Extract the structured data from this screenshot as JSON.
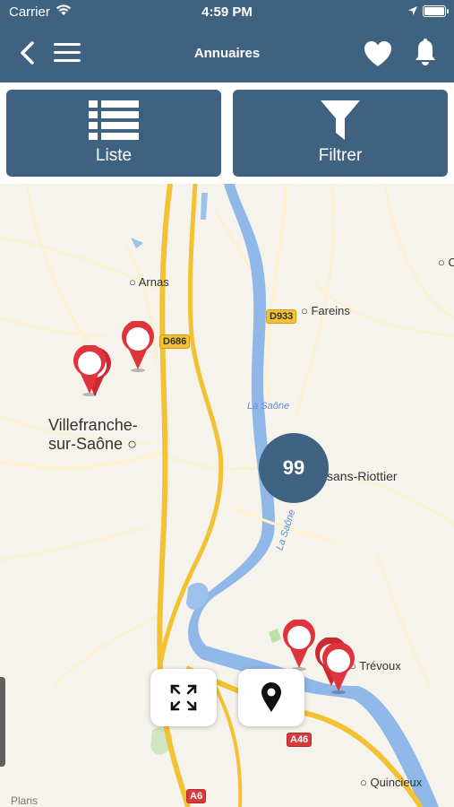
{
  "status_bar": {
    "carrier": "Carrier",
    "time": "4:59 PM"
  },
  "nav": {
    "title": "Annuaires"
  },
  "toolbar": {
    "list_label": "Liste",
    "filter_label": "Filtrer"
  },
  "map": {
    "places": {
      "arnas": "Arnas",
      "fareins": "Fareins",
      "villefranche_line1": "Villefranche-",
      "villefranche_line2": "sur-Saône",
      "riottier": "sans-Riottier",
      "trevoux": "Trévoux",
      "quincieux": "Quincieux"
    },
    "roads": {
      "d686": "D686",
      "d933": "D933",
      "a46": "A46",
      "a6": "A6"
    },
    "river_labels": {
      "saone_top": "La Saône",
      "saone_mid": "La Saône"
    },
    "cluster_count": "99",
    "attribution": "Plans"
  },
  "colors": {
    "header": "#3f6280",
    "pin": "#e0343c",
    "highway": "#f2c233",
    "water": "#8fb8e8"
  }
}
